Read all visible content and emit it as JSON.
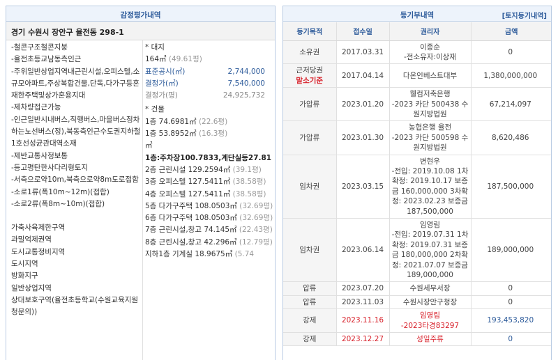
{
  "appraisal": {
    "title": "감정평가내역",
    "address": "경기 수원시 장안구 율전동 298-1",
    "features": [
      "-철콘구조철콘지붕",
      "-율전초등교남동측인근",
      "-주위일반상업지역내근린시설,오피스텔,소규모아파트,주상복합건물,단독,다가구등혼재한주택및상가혼용지대",
      "-제차량접근가능",
      "-인근일반시내버스,직행버스,마을버스정차하는노선버스(정),북동측인근수도권지하철1호선성균관대역소재",
      "-제반교통사정보통",
      "-등고평탄한사다리형토지",
      "-서측으로약10m,북측으로약8m도로접함",
      "-소로1류(폭10m~12m)(접합)",
      "-소로2류(폭8m~10m)(접합)"
    ],
    "zoning": [
      "가축사육제한구역",
      "과밀억제권역",
      "도시교통정비지역",
      "도시지역",
      "방화지구",
      "일반상업지역",
      "상대보호구역(율전초등학교(수원교육지원청문의))"
    ],
    "land": {
      "head": "* 대지",
      "area": "164㎡",
      "area_pyeong": "(49.61평)",
      "official_label": "표준공시(㎡)",
      "official_value": "2,744,000",
      "decided_label": "결정가(㎡)",
      "decided_value": "7,540,000",
      "decided_pyeong_label": "결정가(평)",
      "decided_pyeong_value": "24,925,732"
    },
    "building": {
      "head": "* 건물",
      "lines": [
        {
          "text": "1층 74.6981㎡",
          "sub": "(22.6평)",
          "strong": false
        },
        {
          "text": "1층 53.8952㎡",
          "sub": "(16.3평)",
          "strong": false
        },
        {
          "text": "㎡",
          "sub": "",
          "strong": false
        },
        {
          "text": "1층:주차장100.7833,계단실등27.81",
          "sub": "",
          "strong": true
        },
        {
          "text": "2층 근린시설 129.2594㎡",
          "sub": "(39.1평)",
          "strong": false
        },
        {
          "text": "3층 오피스텔 127.5411㎡",
          "sub": "(38.58평)",
          "strong": false
        },
        {
          "text": "4층 오피스텔 127.5411㎡",
          "sub": "(38.58평)",
          "strong": false
        },
        {
          "text": "5층 다가구주택 108.0503㎡",
          "sub": "(32.69평)",
          "strong": false
        },
        {
          "text": "6층 다가구주택 108.0503㎡",
          "sub": "(32.69평)",
          "strong": false
        },
        {
          "text": "7층 근린시설,창고 74.145㎡",
          "sub": "(22.43평)",
          "strong": false
        },
        {
          "text": "8층 근린시설,창고 42.296㎡",
          "sub": "(12.79평)",
          "strong": false
        },
        {
          "text": "지하1층 기계실 18.9675㎡",
          "sub": "(5.74",
          "strong": false
        }
      ]
    }
  },
  "registry": {
    "title": "등기부내역",
    "link": "[토지등기내역]",
    "headers": [
      "등기목적",
      "접수일",
      "권리자",
      "금액"
    ],
    "rows": [
      {
        "purpose": "소유권",
        "flag": "",
        "date": "2017.03.31",
        "holder": "이종순\n-전소유자:이상재",
        "amount": "0",
        "red": false
      },
      {
        "purpose": "근저당권",
        "flag": "말소기준",
        "date": "2017.04.14",
        "holder": "다온인베스트대부",
        "amount": "1,380,000,000",
        "red": false
      },
      {
        "purpose": "가압류",
        "flag": "",
        "date": "2023.01.20",
        "holder": "웰컴저축은행\n-2023 카단 500438 수원지방법원",
        "amount": "67,214,097",
        "red": false
      },
      {
        "purpose": "가압류",
        "flag": "",
        "date": "2023.01.30",
        "holder": "농협은행 율전\n-2023 카단 500598 수원지방법원",
        "amount": "8,620,486",
        "red": false
      },
      {
        "purpose": "임차권",
        "flag": "",
        "date": "2023.03.15",
        "holder": "변현우\n-전입: 2019.10.08 1차확정: 2019.10.17 보증금 160,000,000 3차확정: 2023.02.23 보증금 187,500,000",
        "amount": "187,500,000",
        "red": false
      },
      {
        "purpose": "임차권",
        "flag": "",
        "date": "2023.06.14",
        "holder": "임영림\n-전입: 2019.07.31 1차확정: 2019.07.31 보증금 180,000,000 2차확정: 2021.07.07 보증금 189,000,000",
        "amount": "189,000,000",
        "red": false
      },
      {
        "purpose": "압류",
        "flag": "",
        "date": "2023.07.20",
        "holder": "수원세무서장",
        "amount": "0",
        "red": false
      },
      {
        "purpose": "압류",
        "flag": "",
        "date": "2023.11.03",
        "holder": "수원시장안구청장",
        "amount": "0",
        "red": false
      },
      {
        "purpose": "강제",
        "flag": "",
        "date": "2023.11.16",
        "holder": "임영림\n-2023타경83297",
        "amount": "193,453,820",
        "red": true
      },
      {
        "purpose": "강제",
        "flag": "",
        "date": "2023.12.27",
        "holder": "성일주류",
        "amount": "0",
        "red": true
      }
    ]
  }
}
